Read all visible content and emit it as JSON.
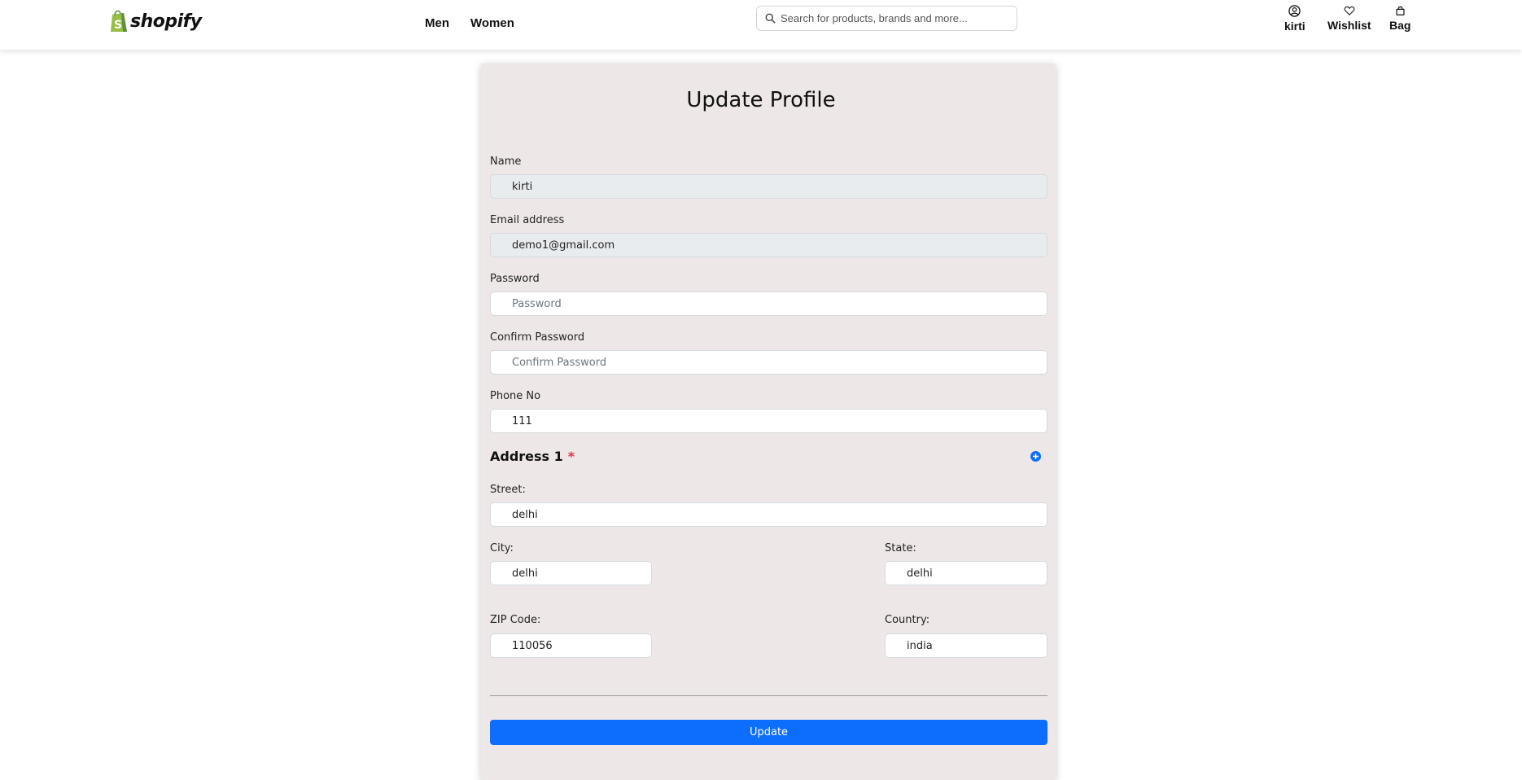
{
  "brand": {
    "name": "shopify",
    "green": "#95bf47"
  },
  "nav": {
    "men": "Men",
    "women": "Women"
  },
  "search": {
    "placeholder": "Search for products, brands and more..."
  },
  "header": {
    "profile": "kirti",
    "wishlist": "Wishlist",
    "bag": "Bag"
  },
  "form": {
    "title": "Update Profile",
    "name": {
      "label": "Name",
      "value": "kirti"
    },
    "email": {
      "label": "Email address",
      "value": "demo1@gmail.com"
    },
    "password": {
      "label": "Password",
      "placeholder": "Password"
    },
    "confirm": {
      "label": "Confirm Password",
      "placeholder": "Confirm Password"
    },
    "phone": {
      "label": "Phone No",
      "value": "111"
    },
    "address": {
      "heading": "Address 1",
      "required_mark": "*",
      "street": {
        "label": "Street:",
        "value": "delhi"
      },
      "city": {
        "label": "City:",
        "value": "delhi"
      },
      "state": {
        "label": "State:",
        "value": "delhi"
      },
      "zip": {
        "label": "ZIP Code:",
        "value": "110056"
      },
      "country": {
        "label": "Country:",
        "value": "india"
      }
    },
    "submit": "Update"
  },
  "colors": {
    "accent": "#0d6efd",
    "card_bg": "#ede8e7",
    "required": "#dc3545"
  }
}
